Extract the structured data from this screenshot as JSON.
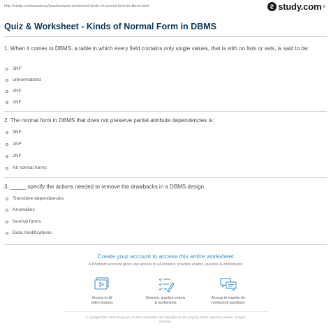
{
  "browser": {
    "url": "http://study.com/academy/practice/quiz-worksheet-kinds-of-normal-form-in-dbms.html"
  },
  "brand": {
    "logo_text": "study.com",
    "logo_mark": "®"
  },
  "page": {
    "title": "Quiz & Worksheet - Kinds of Normal Form in DBMS"
  },
  "questions": [
    {
      "text": "1. When it comes to DBMS, a table in which every field contains only single values, that is with no lists or sets, is said to be:",
      "options": [
        "3NF",
        "unnormalized",
        "2NF",
        "1NF"
      ]
    },
    {
      "text": "2. The normal form in DBMS that does not preserve partial attribute dependencies is:",
      "options": [
        "3NF",
        "1NF",
        "2NF",
        "All normal forms"
      ]
    },
    {
      "text": "3. _____ specify the actions needed to remove the drawbacks in a DBMS design.",
      "options": [
        "Transitive dependencies",
        "Anomalies",
        "Normal forms",
        "Data modifications"
      ]
    }
  ],
  "cta": {
    "title": "Create your account to access this entire worksheet",
    "subtitle": "A Premium account gives you access to all lessons, practice exams, quizzes & worksheets",
    "features": [
      {
        "line1": "Access to all",
        "line2": "video lessons",
        "icon": "video-lessons-icon"
      },
      {
        "line1": "Quizzes, practice exams",
        "line2": "& worksheets",
        "icon": "quizzes-checklist-icon"
      },
      {
        "line1": "Access to experts for",
        "line2": "homework questions",
        "icon": "experts-chat-icon"
      }
    ]
  },
  "footer": {
    "line1": "© copyright 2003-2020 Study.com. All other trademarks and copyrights are the property of their respective owners. All rights",
    "line2": "reserved."
  },
  "colors": {
    "title": "#0a3556",
    "accent": "#3a8bc9",
    "rule": "#cfcfcf"
  }
}
